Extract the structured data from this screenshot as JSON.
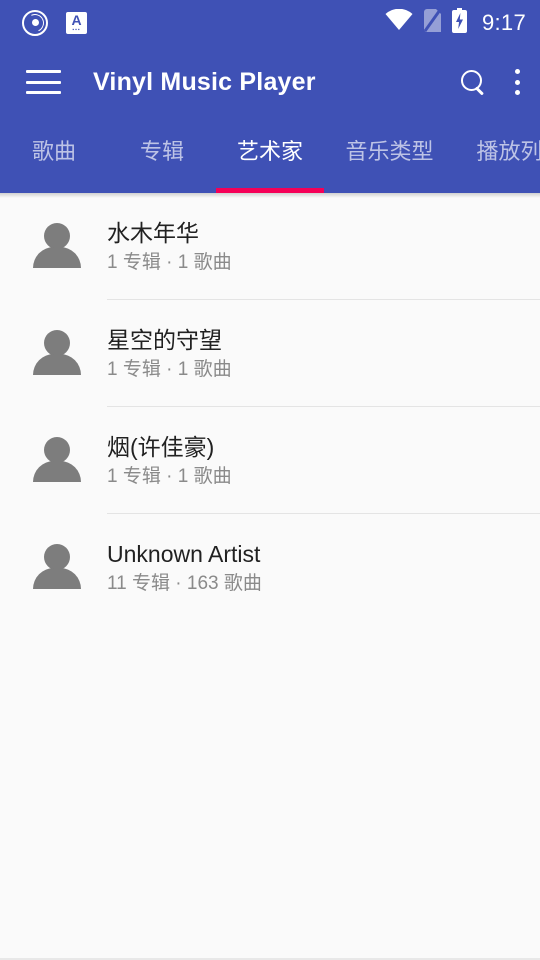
{
  "theme": {
    "primary": "#3f51b5",
    "accent": "#f50057",
    "background": "#fafafa",
    "title_color": "#212121",
    "subtitle_color": "#8a8a8a",
    "divider_color": "#e4e4e4"
  },
  "status_bar": {
    "icons_left": [
      "vinyl-disc-icon",
      "keyboard-input-a-icon"
    ],
    "icons_right": [
      "wifi-icon",
      "no-sim-icon",
      "battery-charging-icon"
    ],
    "clock": "9:17",
    "a_badge_letter": "A"
  },
  "app_bar": {
    "menu_icon": "hamburger-menu-icon",
    "title": "Vinyl Music Player",
    "search_icon": "search-icon",
    "overflow_icon": "more-vert-icon"
  },
  "tabs": {
    "active_index": 2,
    "items": [
      {
        "label": "歌曲"
      },
      {
        "label": "专辑"
      },
      {
        "label": "艺术家"
      },
      {
        "label": "音乐类型"
      },
      {
        "label": "播放列表"
      }
    ]
  },
  "artist_list": {
    "items": [
      {
        "name": "水木年华",
        "meta": "1 专辑 · 1 歌曲",
        "avatar": "person-icon"
      },
      {
        "name": "星空的守望",
        "meta": "1 专辑 · 1 歌曲",
        "avatar": "person-icon"
      },
      {
        "name": "烟(许佳豪)",
        "meta": "1 专辑 · 1 歌曲",
        "avatar": "person-icon"
      },
      {
        "name": "Unknown Artist",
        "meta": "11 专辑 · 163 歌曲",
        "avatar": "person-icon"
      }
    ]
  }
}
